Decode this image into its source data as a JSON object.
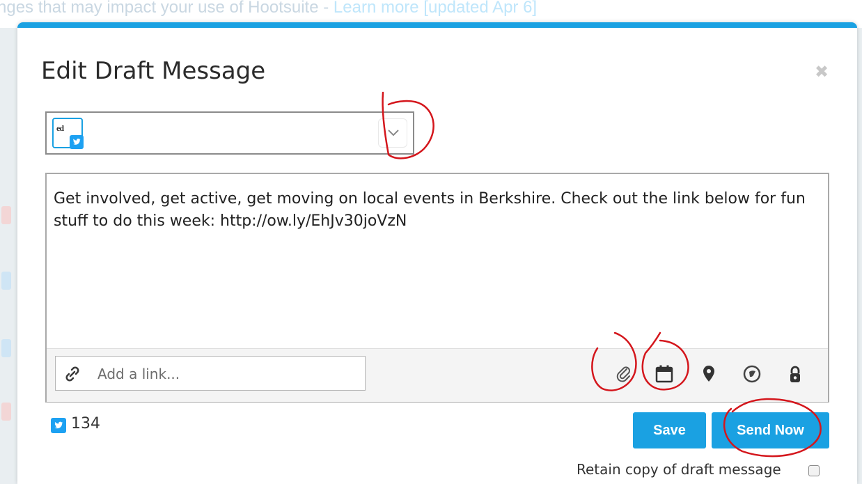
{
  "banner": {
    "text": "nges that may impact your use of Hootsuite - ",
    "link": "Learn more [updated Apr 6]"
  },
  "modal": {
    "title": "Edit Draft Message",
    "close_icon": "close-icon"
  },
  "profile_selector": {
    "avatar_text": "ed",
    "network": "twitter",
    "chevron_icon": "chevron-down-icon"
  },
  "composer": {
    "message": "Get involved, get active, get moving on local events in Berkshire. Check out the link below for fun stuff to do this week: http://ow.ly/EhJv30joVzN",
    "link_placeholder": "Add a link...",
    "toolbar_icons": [
      "link-icon",
      "paperclip-icon",
      "calendar-icon",
      "location-pin-icon",
      "targeting-globe-icon",
      "privacy-lock-icon"
    ]
  },
  "char_count": {
    "network": "twitter",
    "value": "134"
  },
  "actions": {
    "save_label": "Save",
    "send_now_label": "Send Now",
    "retain_label": "Retain copy of draft message",
    "retain_checked": false
  },
  "colors": {
    "accent": "#1aa1e2",
    "twitter": "#1da1f2",
    "annotation": "#d4161c"
  }
}
